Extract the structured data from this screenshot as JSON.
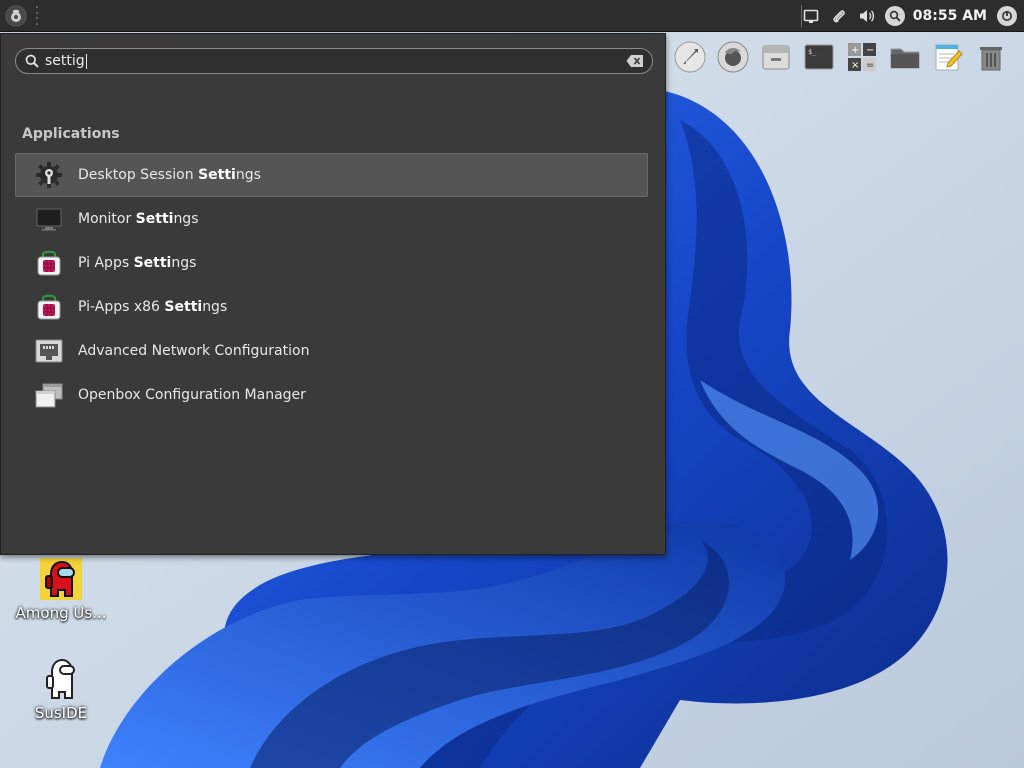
{
  "panel": {
    "menu_icon": "raspberry-menu-icon",
    "clock": "08:55 AM",
    "tray_icons": [
      "screen-icon",
      "clip-icon",
      "volume-icon",
      "search-icon",
      "power-icon"
    ]
  },
  "dock": {
    "items": [
      "rocket-icon",
      "firefox-icon",
      "file-manager-icon",
      "terminal-icon",
      "calculator-icon",
      "folder-icon",
      "text-editor-icon",
      "trash-icon"
    ]
  },
  "menu": {
    "search": {
      "value": "settig"
    },
    "section_title": "Applications",
    "apps": [
      {
        "pre": "Desktop Session ",
        "bold": "Setti",
        "post": "ngs",
        "icon": "gear-wrench-icon",
        "selected": true
      },
      {
        "pre": "Monitor ",
        "bold": "Setti",
        "post": "ngs",
        "icon": "monitor-icon"
      },
      {
        "pre": "Pi Apps ",
        "bold": "Setti",
        "post": "ngs",
        "icon": "pi-apps-icon"
      },
      {
        "pre": "Pi-Apps x86 ",
        "bold": "Setti",
        "post": "ngs",
        "icon": "pi-apps-icon"
      },
      {
        "pre": "Advanced Network Configuration",
        "bold": "",
        "post": "",
        "icon": "network-icon"
      },
      {
        "pre": "Openbox Configuration Manager",
        "bold": "",
        "post": "",
        "icon": "windows-icon"
      }
    ]
  },
  "desktop": {
    "icons": [
      {
        "label": "Among Us...",
        "icon": "among-us-icon"
      },
      {
        "label": "SusIDE",
        "icon": "suside-icon"
      }
    ]
  },
  "colors": {
    "panel_bg": "#2d2d2d",
    "menu_bg": "#3a3a3a",
    "selected_bg": "#555555",
    "wallpaper_blue": "#1a4fd8"
  }
}
